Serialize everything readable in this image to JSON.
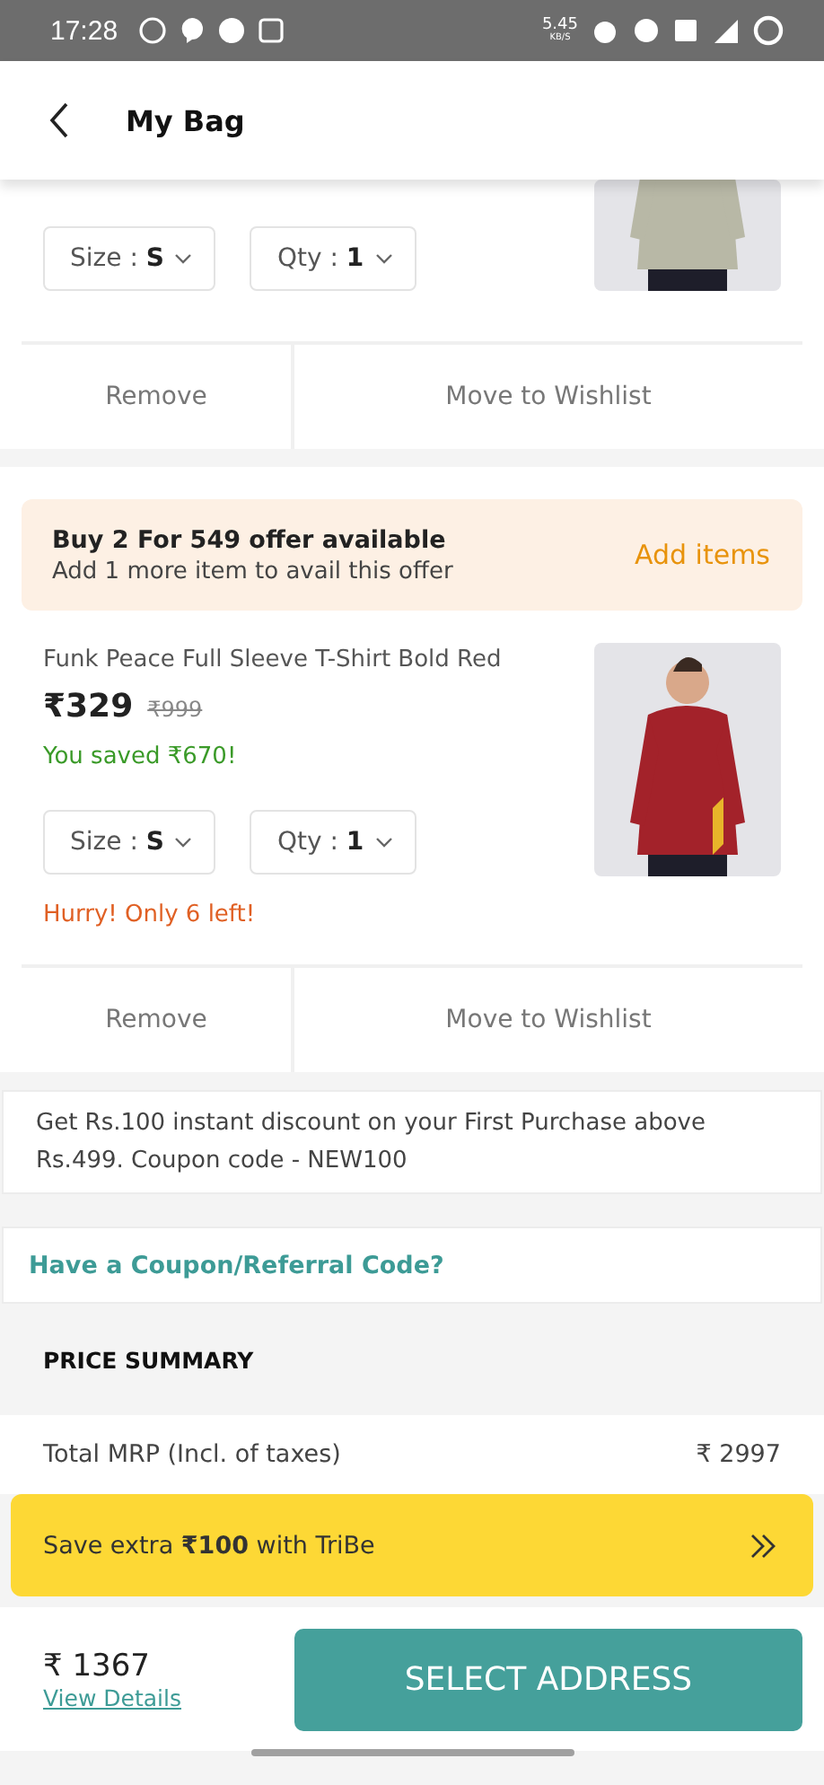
{
  "status_bar": {
    "time": "17:28",
    "net_speed": "5.45",
    "net_unit": "KB/S"
  },
  "header": {
    "title": "My Bag"
  },
  "items": [
    {
      "kind": "cropped",
      "size": "Size : **S**",
      "qty": "Qty : **1**",
      "actions": [
        "Remove",
        "Move to Wishlist"
      ]
    },
    {
      "kind": "full",
      "offer": {
        "title": "Buy 2 For 549 offer available",
        "subtitle": "Add 1 more item to avail this offer",
        "action": "Add items"
      },
      "name": "Funk Peace Full Sleeve T-Shirt Bold Red",
      "price": "₹329",
      "mrp": "₹999",
      "saved": "You saved ₹670!",
      "size": "Size : **S**",
      "qty": "Qty : **1**",
      "stock_note": "Hurry! Only 6 left!",
      "actions": [
        "Remove",
        "Move to Wishlist"
      ]
    }
  ],
  "promo": "Get Rs.100 instant discount on your First Purchase above Rs.499. Coupon code - NEW100",
  "coupon_link": "Have a Coupon/Referral Code?",
  "price_summary": {
    "title": "PRICE SUMMARY",
    "rows": [
      {
        "label": "Total MRP (Incl. of taxes)",
        "value": "₹ 2997"
      }
    ]
  },
  "tribe_banner": "Save extra **₹100** with TriBe",
  "footer": {
    "total": "₹ 1367",
    "details_link": "View Details",
    "cta": "SELECT ADDRESS"
  }
}
